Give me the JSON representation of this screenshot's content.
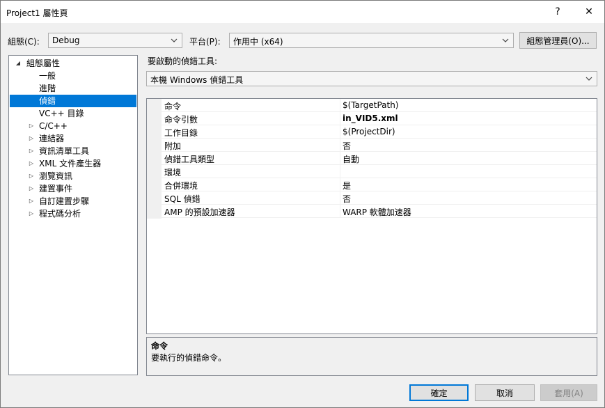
{
  "window": {
    "title": "Project1 屬性頁",
    "help_label": "?",
    "close_label": "✕"
  },
  "toolbar": {
    "config_label": "組態(C):",
    "config_value": "Debug",
    "platform_label": "平台(P):",
    "platform_value": "作用中 (x64)",
    "config_manager_label": "組態管理員(O)..."
  },
  "tree": {
    "items": [
      {
        "label": "組態屬性",
        "expander": "◢"
      },
      {
        "label": "一般",
        "expander": ""
      },
      {
        "label": "進階",
        "expander": ""
      },
      {
        "label": "偵錯",
        "expander": "",
        "selected": true
      },
      {
        "label": "VC++ 目錄",
        "expander": ""
      },
      {
        "label": "C/C++",
        "expander": "▷"
      },
      {
        "label": "連結器",
        "expander": "▷"
      },
      {
        "label": "資訊清單工具",
        "expander": "▷"
      },
      {
        "label": "XML 文件產生器",
        "expander": "▷"
      },
      {
        "label": "瀏覽資訊",
        "expander": "▷"
      },
      {
        "label": "建置事件",
        "expander": "▷"
      },
      {
        "label": "自訂建置步驟",
        "expander": "▷"
      },
      {
        "label": "程式碼分析",
        "expander": "▷"
      }
    ]
  },
  "debugger": {
    "label": "要啟動的偵錯工具:",
    "value": "本機 Windows 偵錯工具"
  },
  "properties": {
    "rows": [
      {
        "name": "命令",
        "value": "$(TargetPath)"
      },
      {
        "name": "命令引數",
        "value": "in_VID5.xml"
      },
      {
        "name": "工作目錄",
        "value": "$(ProjectDir)"
      },
      {
        "name": "附加",
        "value": "否"
      },
      {
        "name": "偵錯工具類型",
        "value": "自動"
      },
      {
        "name": "環境",
        "value": ""
      },
      {
        "name": "合併環境",
        "value": "是"
      },
      {
        "name": "SQL 偵錯",
        "value": "否"
      },
      {
        "name": "AMP 的預設加速器",
        "value": "WARP 軟體加速器"
      }
    ]
  },
  "description": {
    "title": "命令",
    "body": "要執行的偵錯命令。"
  },
  "buttons": {
    "ok": "確定",
    "cancel": "取消",
    "apply": "套用(A)"
  }
}
